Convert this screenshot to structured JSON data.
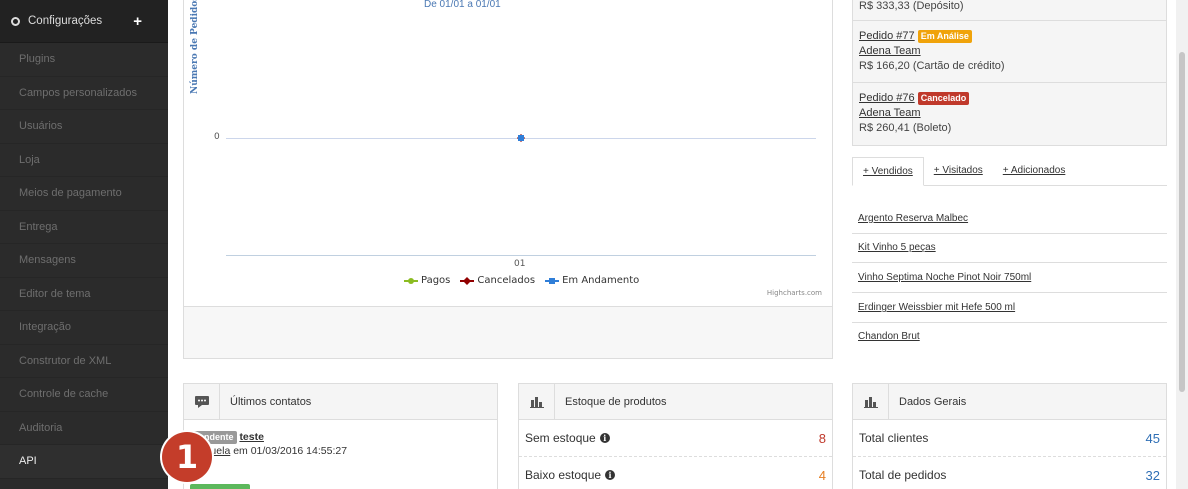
{
  "sidebar": {
    "header": {
      "label": "Configurações",
      "add_icon": "+"
    },
    "items": [
      {
        "label": "Plugins"
      },
      {
        "label": "Campos personalizados"
      },
      {
        "label": "Usuários"
      },
      {
        "label": "Loja"
      },
      {
        "label": "Meios de pagamento"
      },
      {
        "label": "Entrega"
      },
      {
        "label": "Mensagens"
      },
      {
        "label": "Editor de tema"
      },
      {
        "label": "Integração"
      },
      {
        "label": "Construtor de XML"
      },
      {
        "label": "Controle de cache"
      },
      {
        "label": "Auditoria"
      },
      {
        "label": "API"
      }
    ]
  },
  "chart": {
    "subtitle": "De 01/01 a 01/01",
    "credits": "Highcharts.com"
  },
  "chart_data": {
    "type": "line",
    "categories": [
      "01"
    ],
    "ylabel": "Número de Pedidos",
    "yticks": [
      "0"
    ],
    "series": [
      {
        "name": "Pagos",
        "values": [
          0
        ],
        "color": "#8bbc21"
      },
      {
        "name": "Cancelados",
        "values": [
          0
        ],
        "color": "#910000"
      },
      {
        "name": "Em Andamento",
        "values": [
          0
        ],
        "color": "#2f7ed8"
      }
    ],
    "legend": "bottom-center"
  },
  "orders": {
    "partial_top": "R$ 333,33 (Depósito)",
    "items": [
      {
        "link": "Pedido #77",
        "badge": "Em Análise",
        "badge_color": "#f0a30a",
        "customer": "Adena Team",
        "amount": "R$ 166,20 (Cartão de crédito)"
      },
      {
        "link": "Pedido #76",
        "badge": "Cancelado",
        "badge_color": "#c0392b",
        "customer": "Adena Team",
        "amount": "R$ 260,41 (Boleto)"
      }
    ]
  },
  "tabs": [
    {
      "label": "+ Vendidos"
    },
    {
      "label": "+ Visitados"
    },
    {
      "label": "+ Adicionados"
    }
  ],
  "products": [
    {
      "label": "Argento Reserva Malbec"
    },
    {
      "label": "Kit Vinho 5 peças"
    },
    {
      "label": "Vinho Septima Noche Pinot Noir 750ml"
    },
    {
      "label": "Erdinger Weissbier mit Hefe 500 ml"
    },
    {
      "label": "Chandon Brut"
    }
  ],
  "contacts_panel": {
    "title": "Últimos contatos",
    "contact": {
      "badge": "Pendente",
      "subject": "teste",
      "author": "Manuela",
      "meta": "em 01/03/2016 14:55:27"
    }
  },
  "stock_panel": {
    "title": "Estoque de produtos",
    "rows": [
      {
        "label": "Sem estoque",
        "value": "8",
        "color": "#c0392b"
      },
      {
        "label": "Baixo estoque",
        "value": "4",
        "color": "#e67e22"
      }
    ]
  },
  "general_panel": {
    "title": "Dados Gerais",
    "rows": [
      {
        "label": "Total clientes",
        "value": "45",
        "color": "#2f6fb5"
      },
      {
        "label": "Total de pedidos",
        "value": "32",
        "color": "#2f6fb5"
      }
    ]
  },
  "callout": {
    "number": "1"
  }
}
